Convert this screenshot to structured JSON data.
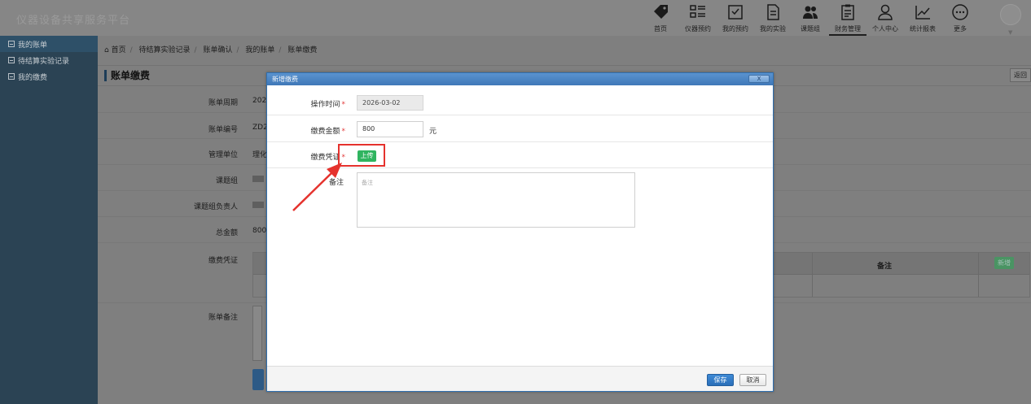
{
  "app": {
    "title": "仪器设备共享服务平台"
  },
  "nav": {
    "items": [
      {
        "label": "首页",
        "icon": "tag-icon"
      },
      {
        "label": "仪器预约",
        "icon": "list-icon"
      },
      {
        "label": "我的预约",
        "icon": "calendar-check-icon"
      },
      {
        "label": "我的实验",
        "icon": "document-icon"
      },
      {
        "label": "课题组",
        "icon": "group-icon"
      },
      {
        "label": "财务管理",
        "icon": "clipboard-icon",
        "active": true
      },
      {
        "label": "个人中心",
        "icon": "user-icon"
      },
      {
        "label": "统计报表",
        "icon": "line-chart-icon"
      },
      {
        "label": "更多",
        "icon": "more-icon"
      }
    ]
  },
  "sidebar": {
    "items": [
      {
        "label": "我的账单",
        "active": true
      },
      {
        "label": "待结算实验记录"
      },
      {
        "label": "我的缴费"
      }
    ]
  },
  "breadcrumb": [
    "首页",
    "待结算实验记录",
    "账单确认",
    "我的账单",
    "账单缴费"
  ],
  "page": {
    "title": "账单缴费",
    "back_label": "返回",
    "fields": [
      {
        "label": "账单周期",
        "value": "202"
      },
      {
        "label": "账单编号",
        "value": "ZD2"
      },
      {
        "label": "管理单位",
        "value": "理化"
      },
      {
        "label": "课题组",
        "value": ""
      },
      {
        "label": "课题组负责人",
        "value": ""
      },
      {
        "label": "总金额",
        "value": "800."
      },
      {
        "label": "缴费凭证",
        "value": ""
      },
      {
        "label": "账单备注",
        "value": ""
      }
    ],
    "voucher_table": {
      "note_header": "备注",
      "add_label": "新增"
    }
  },
  "modal": {
    "title": "新增缴费",
    "close_label": "X",
    "op_time": {
      "label": "操作时间",
      "value": "2026-03-02"
    },
    "amount": {
      "label": "缴费金额",
      "value": "800",
      "unit": "元"
    },
    "voucher": {
      "label": "缴费凭证",
      "upload_label": "上传"
    },
    "note": {
      "label": "备注",
      "placeholder": "备注"
    },
    "save_label": "保存",
    "cancel_label": "取消"
  },
  "colors": {
    "highlight": "#e5322d",
    "upload": "#2fb45f",
    "primary": "#2a6fb8"
  }
}
